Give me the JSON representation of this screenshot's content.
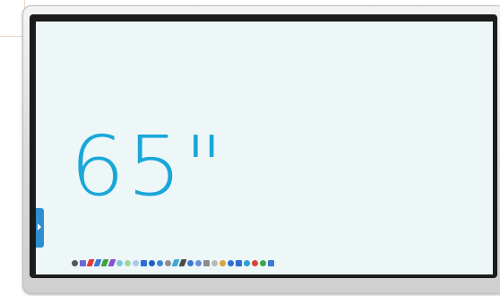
{
  "screen": {
    "size_label": "65\"",
    "accent": "#1aa7d8"
  },
  "toolbar": {
    "items": [
      {
        "icon": "cursor-icon",
        "color": "#555555"
      },
      {
        "icon": "brush-icon",
        "color": "#6b6bd6"
      },
      {
        "icon": "pen-red-icon",
        "color": "#e23b3b"
      },
      {
        "icon": "pen-blue-icon",
        "color": "#3a7bd5"
      },
      {
        "icon": "pen-green-icon",
        "color": "#3ca53c"
      },
      {
        "icon": "pen-purple-icon",
        "color": "#8a4fd1"
      },
      {
        "icon": "highlighter-icon",
        "color": "#7cc8d8"
      },
      {
        "icon": "eraser-icon",
        "color": "#9fd6a5"
      },
      {
        "icon": "clear-icon",
        "color": "#a7c9ef"
      },
      {
        "icon": "circle-icon",
        "color": "#2c6fd6"
      },
      {
        "icon": "shape-icon",
        "color": "#1f5fbf"
      },
      {
        "icon": "select-icon",
        "color": "#3a89d6"
      },
      {
        "icon": "lasso-icon",
        "color": "#8e8e8e"
      },
      {
        "icon": "pencil-icon",
        "color": "#3fa9d4"
      },
      {
        "icon": "marker-icon",
        "color": "#4b4b4b"
      },
      {
        "icon": "laser-icon",
        "color": "#3a7bd5"
      },
      {
        "icon": "text-icon",
        "color": "#6a8fd8"
      },
      {
        "icon": "table-icon",
        "color": "#8c8c8c"
      },
      {
        "icon": "grid-icon",
        "color": "#b9b9b9"
      },
      {
        "icon": "ruler-icon",
        "color": "#d8a23b"
      },
      {
        "icon": "undo-icon",
        "color": "#2e6fd0"
      },
      {
        "icon": "redo-icon",
        "color": "#2e6fd0"
      },
      {
        "icon": "screenshot-icon",
        "color": "#2aa0d8"
      },
      {
        "icon": "record-icon",
        "color": "#d8463b"
      },
      {
        "icon": "settings-icon",
        "color": "#3aaa4a"
      },
      {
        "icon": "exit-icon",
        "color": "#3a7bd5"
      }
    ]
  }
}
